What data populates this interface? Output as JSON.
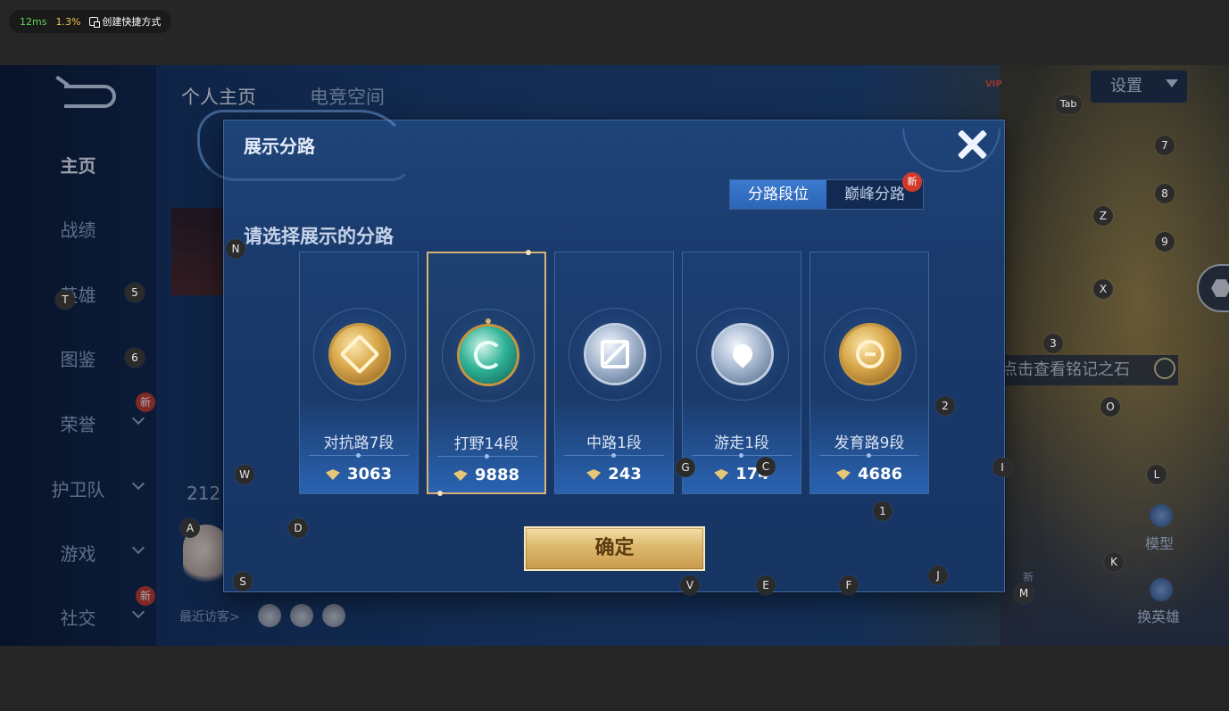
{
  "perf": {
    "latency": "12ms",
    "cpu": "1.3%",
    "shortcut": "创建快捷方式"
  },
  "colors": {
    "accent_blue": "#2d65b6",
    "gold": "#d9b274",
    "bg_top": "#262626",
    "modal_bg": "#1a3a6c"
  },
  "sidebar": {
    "items": [
      {
        "label": "主页",
        "active": true
      },
      {
        "label": "战绩"
      },
      {
        "label": "英雄"
      },
      {
        "label": "图鉴"
      },
      {
        "label": "荣誉",
        "badge": "新"
      },
      {
        "label": "护卫队"
      },
      {
        "label": "游戏"
      },
      {
        "label": "社交",
        "badge": "新"
      }
    ]
  },
  "header": {
    "tabs": [
      "个人主页",
      "电竞空间"
    ],
    "settings": "设置",
    "vip": "VIP"
  },
  "background": {
    "profile_number": "212",
    "visitors_label": "最近访客>",
    "mingji": "点击查看铭记之石",
    "right_actions": [
      "模型",
      "换英雄"
    ],
    "new_badge": "新"
  },
  "modal": {
    "title": "展示分路",
    "tabs": [
      {
        "label": "分路段位",
        "active": true
      },
      {
        "label": "巅峰分路",
        "badge": "新"
      }
    ],
    "prompt": "请选择展示的分路",
    "cards": [
      {
        "name": "对抗路7段",
        "score": "3063",
        "medal": "gold",
        "icon": "sword-icon",
        "selected": false
      },
      {
        "name": "打野14段",
        "score": "9888",
        "medal": "jade",
        "icon": "dragon-icon",
        "selected": true
      },
      {
        "name": "中路1段",
        "score": "243",
        "medal": "silver",
        "icon": "mid-lane-icon",
        "selected": false
      },
      {
        "name": "游走1段",
        "score": "174",
        "medal": "silver",
        "icon": "roam-icon",
        "selected": false
      },
      {
        "name": "发育路9段",
        "score": "4686",
        "medal": "gold",
        "icon": "adc-icon",
        "selected": false
      }
    ],
    "confirm": "确定",
    "close_icon": "close-icon"
  },
  "hotkeys": [
    "Tab",
    "7",
    "8",
    "Z",
    "9",
    "X",
    "3",
    "5",
    "T",
    "6",
    "N",
    "2",
    "O",
    "W",
    "G",
    "C",
    "I",
    "L",
    "1",
    "A",
    "D",
    "K",
    "S",
    "V",
    "E",
    "F",
    "J",
    "M"
  ]
}
